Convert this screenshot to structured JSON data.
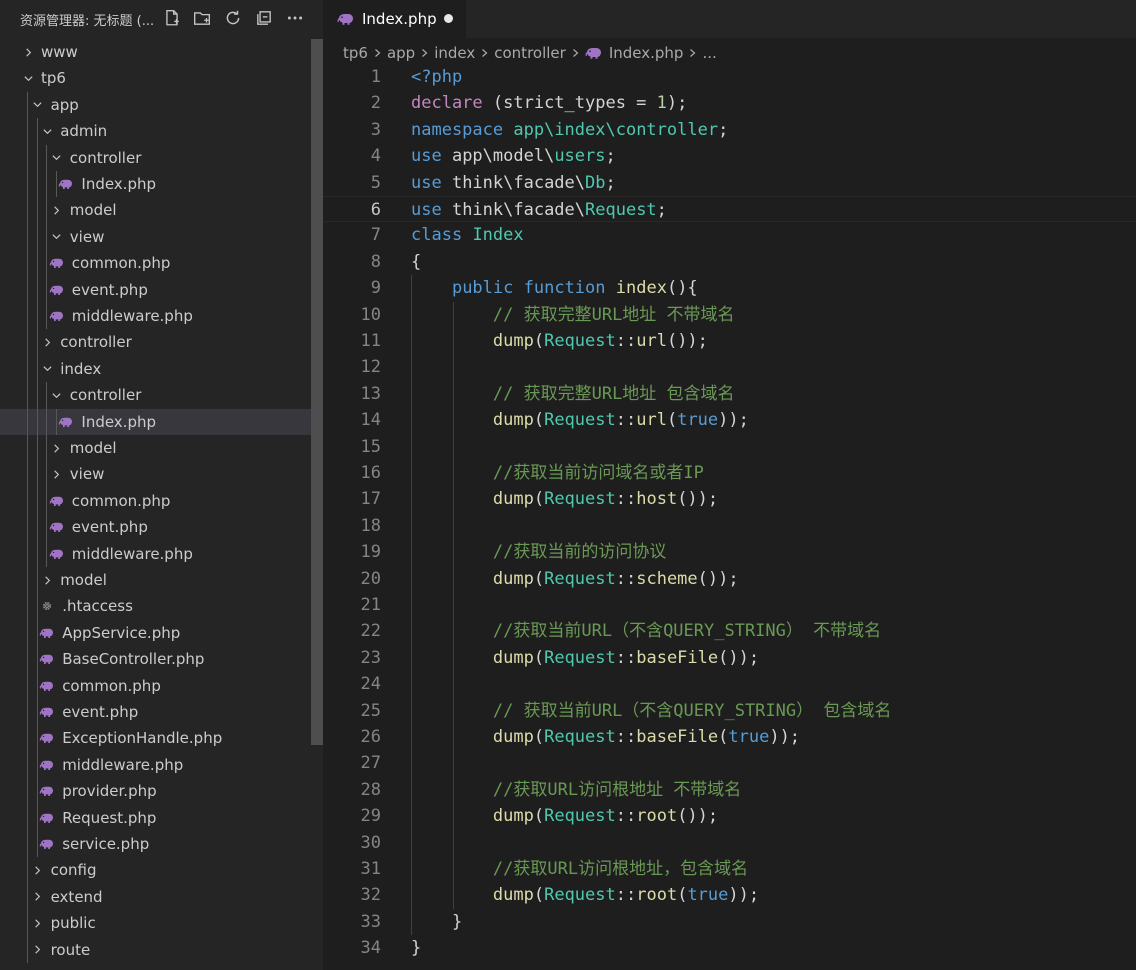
{
  "explorer": {
    "title": "资源管理器: 无标题 (...",
    "tree": [
      {
        "label": "www",
        "depth": 0,
        "type": "folder",
        "expanded": false
      },
      {
        "label": "tp6",
        "depth": 0,
        "type": "folder",
        "expanded": true
      },
      {
        "label": "app",
        "depth": 1,
        "type": "folder",
        "expanded": true
      },
      {
        "label": "admin",
        "depth": 2,
        "type": "folder",
        "expanded": true
      },
      {
        "label": "controller",
        "depth": 3,
        "type": "folder",
        "expanded": true
      },
      {
        "label": "Index.php",
        "depth": 4,
        "type": "php"
      },
      {
        "label": "model",
        "depth": 3,
        "type": "folder",
        "expanded": false
      },
      {
        "label": "view",
        "depth": 3,
        "type": "folder",
        "expanded": true
      },
      {
        "label": "common.php",
        "depth": 3,
        "type": "php"
      },
      {
        "label": "event.php",
        "depth": 3,
        "type": "php"
      },
      {
        "label": "middleware.php",
        "depth": 3,
        "type": "php"
      },
      {
        "label": "controller",
        "depth": 2,
        "type": "folder",
        "expanded": false
      },
      {
        "label": "index",
        "depth": 2,
        "type": "folder",
        "expanded": true
      },
      {
        "label": "controller",
        "depth": 3,
        "type": "folder",
        "expanded": true
      },
      {
        "label": "Index.php",
        "depth": 4,
        "type": "php",
        "selected": true
      },
      {
        "label": "model",
        "depth": 3,
        "type": "folder",
        "expanded": false
      },
      {
        "label": "view",
        "depth": 3,
        "type": "folder",
        "expanded": false
      },
      {
        "label": "common.php",
        "depth": 3,
        "type": "php"
      },
      {
        "label": "event.php",
        "depth": 3,
        "type": "php"
      },
      {
        "label": "middleware.php",
        "depth": 3,
        "type": "php"
      },
      {
        "label": "model",
        "depth": 2,
        "type": "folder",
        "expanded": false
      },
      {
        "label": ".htaccess",
        "depth": 2,
        "type": "config"
      },
      {
        "label": "AppService.php",
        "depth": 2,
        "type": "php"
      },
      {
        "label": "BaseController.php",
        "depth": 2,
        "type": "php"
      },
      {
        "label": "common.php",
        "depth": 2,
        "type": "php"
      },
      {
        "label": "event.php",
        "depth": 2,
        "type": "php"
      },
      {
        "label": "ExceptionHandle.php",
        "depth": 2,
        "type": "php"
      },
      {
        "label": "middleware.php",
        "depth": 2,
        "type": "php"
      },
      {
        "label": "provider.php",
        "depth": 2,
        "type": "php"
      },
      {
        "label": "Request.php",
        "depth": 2,
        "type": "php"
      },
      {
        "label": "service.php",
        "depth": 2,
        "type": "php"
      },
      {
        "label": "config",
        "depth": 1,
        "type": "folder",
        "expanded": false
      },
      {
        "label": "extend",
        "depth": 1,
        "type": "folder",
        "expanded": false
      },
      {
        "label": "public",
        "depth": 1,
        "type": "folder",
        "expanded": false
      },
      {
        "label": "route",
        "depth": 1,
        "type": "folder",
        "expanded": false
      }
    ]
  },
  "tab": {
    "label": "Index.php"
  },
  "breadcrumb": [
    "tp6",
    "app",
    "index",
    "controller",
    "Index.php",
    "..."
  ],
  "editor": {
    "current_line": 6,
    "lines": [
      [
        [
          "<?php",
          "kw"
        ]
      ],
      [
        [
          "declare",
          "ctrl"
        ],
        [
          " (strict_types = ",
          "txt"
        ],
        [
          "1",
          "num"
        ],
        [
          ");",
          "txt"
        ]
      ],
      [
        [
          "namespace",
          "kw"
        ],
        [
          " ",
          "txt"
        ],
        [
          "app\\index\\controller",
          "cls"
        ],
        [
          ";",
          "txt"
        ]
      ],
      [
        [
          "use",
          "kw"
        ],
        [
          " app\\model\\",
          "txt"
        ],
        [
          "users",
          "cls"
        ],
        [
          ";",
          "txt"
        ]
      ],
      [
        [
          "use",
          "kw"
        ],
        [
          " think\\facade\\",
          "txt"
        ],
        [
          "Db",
          "cls"
        ],
        [
          ";",
          "txt"
        ]
      ],
      [
        [
          "use",
          "kw"
        ],
        [
          " think\\facade\\",
          "txt"
        ],
        [
          "Request",
          "cls"
        ],
        [
          ";",
          "txt"
        ]
      ],
      [
        [
          "class",
          "kw"
        ],
        [
          " ",
          "txt"
        ],
        [
          "Index",
          "cls"
        ]
      ],
      [
        [
          "{",
          "txt"
        ]
      ],
      [
        [
          "    ",
          "txt"
        ],
        [
          "public",
          "kw"
        ],
        [
          " ",
          "txt"
        ],
        [
          "function",
          "kw"
        ],
        [
          " ",
          "txt"
        ],
        [
          "index",
          "fn"
        ],
        [
          "(){",
          "txt"
        ]
      ],
      [
        [
          "        ",
          "txt"
        ],
        [
          "// 获取完整URL地址 不带域名",
          "com"
        ]
      ],
      [
        [
          "        ",
          "txt"
        ],
        [
          "dump",
          "fn"
        ],
        [
          "(",
          "txt"
        ],
        [
          "Request",
          "cls"
        ],
        [
          "::",
          "txt"
        ],
        [
          "url",
          "fn"
        ],
        [
          "());",
          "txt"
        ]
      ],
      [],
      [
        [
          "        ",
          "txt"
        ],
        [
          "// 获取完整URL地址 包含域名",
          "com"
        ]
      ],
      [
        [
          "        ",
          "txt"
        ],
        [
          "dump",
          "fn"
        ],
        [
          "(",
          "txt"
        ],
        [
          "Request",
          "cls"
        ],
        [
          "::",
          "txt"
        ],
        [
          "url",
          "fn"
        ],
        [
          "(",
          "txt"
        ],
        [
          "true",
          "kw"
        ],
        [
          "));",
          "txt"
        ]
      ],
      [],
      [
        [
          "        ",
          "txt"
        ],
        [
          "//获取当前访问域名或者IP",
          "com"
        ]
      ],
      [
        [
          "        ",
          "txt"
        ],
        [
          "dump",
          "fn"
        ],
        [
          "(",
          "txt"
        ],
        [
          "Request",
          "cls"
        ],
        [
          "::",
          "txt"
        ],
        [
          "host",
          "fn"
        ],
        [
          "());",
          "txt"
        ]
      ],
      [],
      [
        [
          "        ",
          "txt"
        ],
        [
          "//获取当前的访问协议",
          "com"
        ]
      ],
      [
        [
          "        ",
          "txt"
        ],
        [
          "dump",
          "fn"
        ],
        [
          "(",
          "txt"
        ],
        [
          "Request",
          "cls"
        ],
        [
          "::",
          "txt"
        ],
        [
          "scheme",
          "fn"
        ],
        [
          "());",
          "txt"
        ]
      ],
      [],
      [
        [
          "        ",
          "txt"
        ],
        [
          "//获取当前URL（不含QUERY_STRING） 不带域名",
          "com"
        ]
      ],
      [
        [
          "        ",
          "txt"
        ],
        [
          "dump",
          "fn"
        ],
        [
          "(",
          "txt"
        ],
        [
          "Request",
          "cls"
        ],
        [
          "::",
          "txt"
        ],
        [
          "baseFile",
          "fn"
        ],
        [
          "());",
          "txt"
        ]
      ],
      [],
      [
        [
          "        ",
          "txt"
        ],
        [
          "// 获取当前URL（不含QUERY_STRING） 包含域名",
          "com"
        ]
      ],
      [
        [
          "        ",
          "txt"
        ],
        [
          "dump",
          "fn"
        ],
        [
          "(",
          "txt"
        ],
        [
          "Request",
          "cls"
        ],
        [
          "::",
          "txt"
        ],
        [
          "baseFile",
          "fn"
        ],
        [
          "(",
          "txt"
        ],
        [
          "true",
          "kw"
        ],
        [
          "));",
          "txt"
        ]
      ],
      [],
      [
        [
          "        ",
          "txt"
        ],
        [
          "//获取URL访问根地址 不带域名",
          "com"
        ]
      ],
      [
        [
          "        ",
          "txt"
        ],
        [
          "dump",
          "fn"
        ],
        [
          "(",
          "txt"
        ],
        [
          "Request",
          "cls"
        ],
        [
          "::",
          "txt"
        ],
        [
          "root",
          "fn"
        ],
        [
          "());",
          "txt"
        ]
      ],
      [],
      [
        [
          "        ",
          "txt"
        ],
        [
          "//获取URL访问根地址，包含域名",
          "com"
        ]
      ],
      [
        [
          "        ",
          "txt"
        ],
        [
          "dump",
          "fn"
        ],
        [
          "(",
          "txt"
        ],
        [
          "Request",
          "cls"
        ],
        [
          "::",
          "txt"
        ],
        [
          "root",
          "fn"
        ],
        [
          "(",
          "txt"
        ],
        [
          "true",
          "kw"
        ],
        [
          "));",
          "txt"
        ]
      ],
      [
        [
          "    }",
          "txt"
        ]
      ],
      [
        [
          "}",
          "txt"
        ]
      ]
    ]
  }
}
